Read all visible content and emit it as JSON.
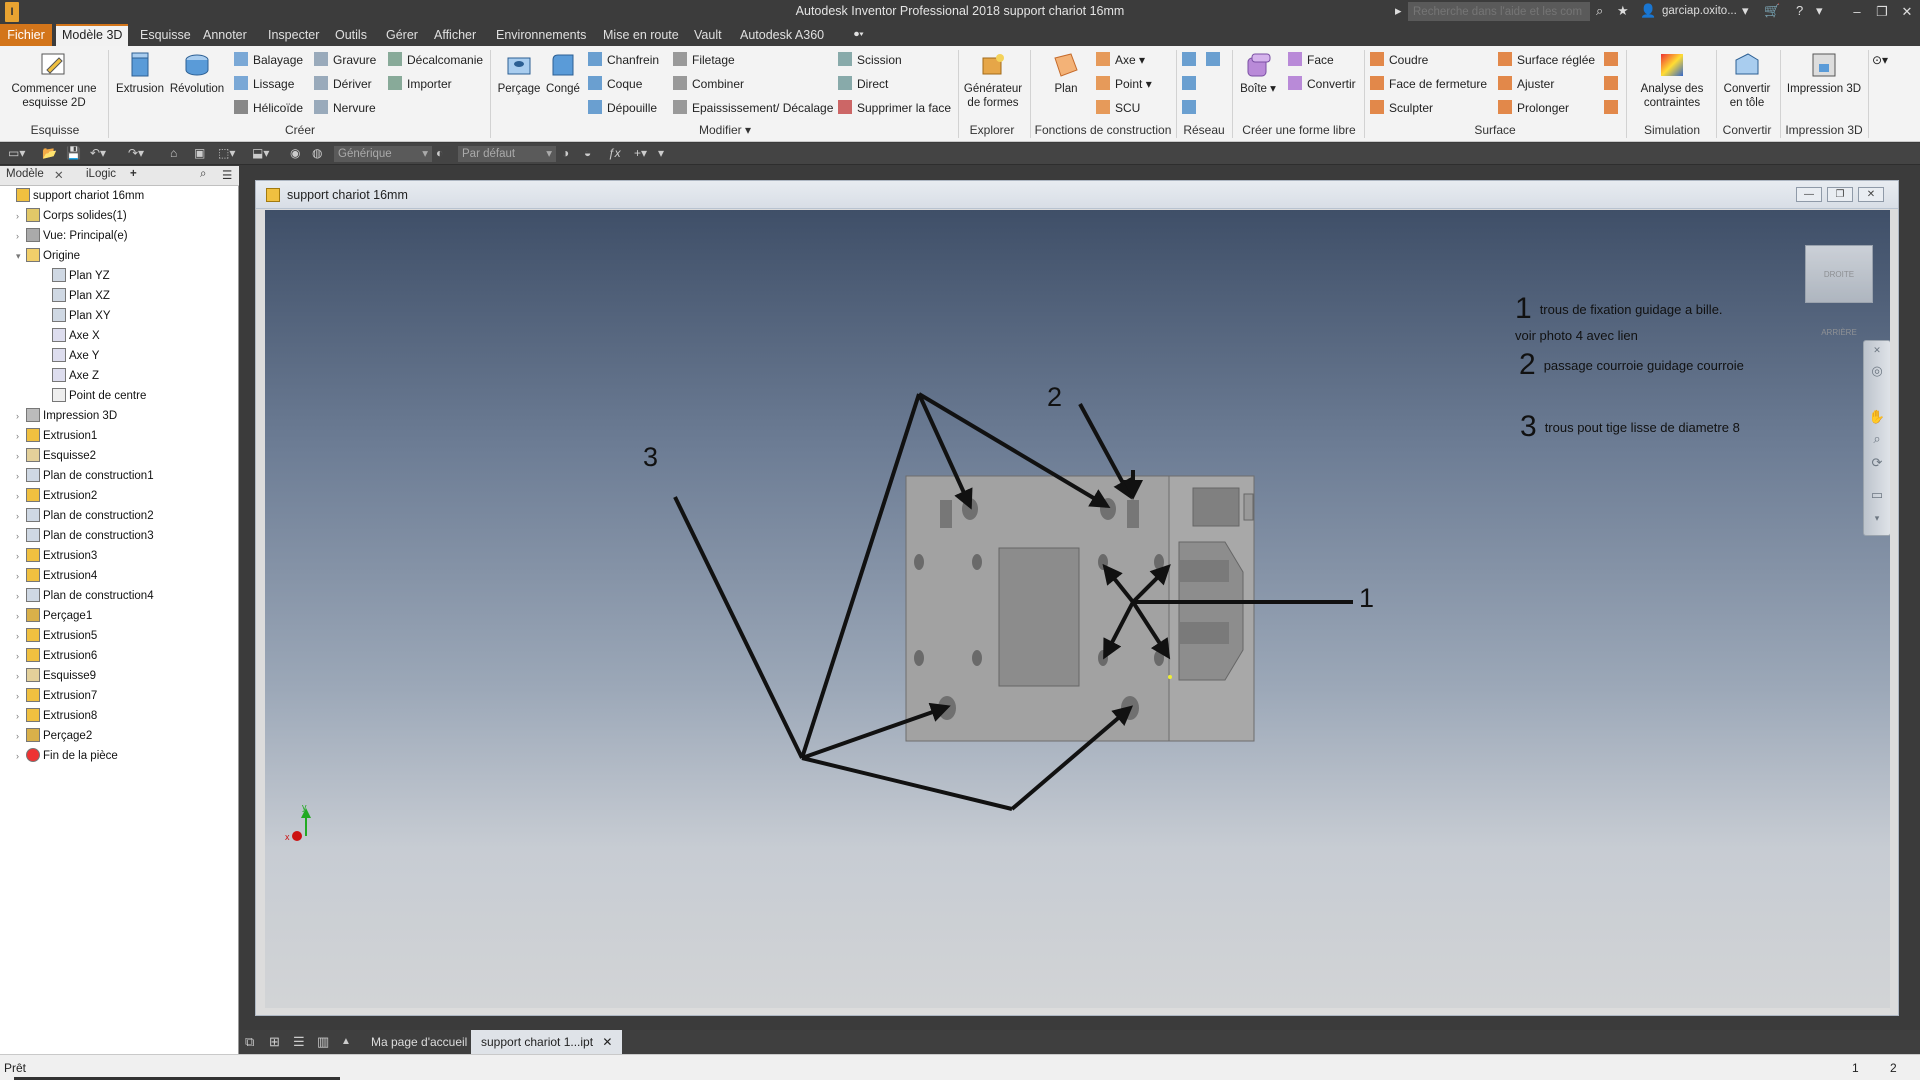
{
  "window": {
    "title": "Autodesk Inventor Professional 2018   support chariot 16mm",
    "logo": "I",
    "help_search_placeholder": "Recherche dans l'aide et les com",
    "user": "garciap.oxito..."
  },
  "menus": [
    "Fichier",
    "Modèle 3D",
    "Esquisse",
    "Annoter",
    "Inspecter",
    "Outils",
    "Gérer",
    "Afficher",
    "Environnements",
    "Mise en route",
    "Vault",
    "Autodesk A360"
  ],
  "ribbon": {
    "panels": {
      "esquisse": "Esquisse",
      "creer": "Créer",
      "modifier": "Modifier",
      "explorer": "Explorer",
      "fonctions": "Fonctions de construction",
      "reseau": "Réseau",
      "forme_libre": "Créer une forme libre",
      "surface": "Surface",
      "simulation": "Simulation",
      "convertir": "Convertir",
      "impression": "Impression 3D"
    },
    "buttons": {
      "commencer": "Commencer une esquisse 2D",
      "extrusion": "Extrusion",
      "revolution": "Révolution",
      "balayage": "Balayage",
      "lissage": "Lissage",
      "helicoide": "Hélicoïde",
      "gravure": "Gravure",
      "deriver": "Dériver",
      "nervure": "Nervure",
      "decalcomanie": "Décalcomanie",
      "importer": "Importer",
      "percage": "Perçage",
      "conge": "Congé",
      "chanfrein": "Chanfrein",
      "coque": "Coque",
      "depouille": "Dépouille",
      "filetage": "Filetage",
      "combiner": "Combiner",
      "epaississement": "Epaississement/ Décalage",
      "scission": "Scission",
      "direct": "Direct",
      "supprimer_face": "Supprimer la face",
      "generateur": "Générateur de formes",
      "plan": "Plan",
      "axe": "Axe",
      "point": "Point",
      "scu": "SCU",
      "boite": "Boîte",
      "face": "Face",
      "convertir_fl": "Convertir",
      "coudre": "Coudre",
      "face_fermeture": "Face de fermeture",
      "sculpter": "Sculpter",
      "surface_reglee": "Surface réglée",
      "ajuster": "Ajuster",
      "prolonger": "Prolonger",
      "analyse": "Analyse des contraintes",
      "convertir_tole": "Convertir en tôle",
      "impression3d": "Impression 3D"
    }
  },
  "qat": {
    "material": "Générique",
    "appearance": "Par défaut"
  },
  "browser": {
    "tabs": [
      "Modèle",
      "iLogic"
    ],
    "items": [
      {
        "label": "support chariot 16mm",
        "level": 0,
        "icon": "part-icon"
      },
      {
        "label": "Corps solides(1)",
        "level": 1,
        "icon": "solid-bodies-icon"
      },
      {
        "label": "Vue: Principal(e)",
        "level": 1,
        "icon": "view-icon"
      },
      {
        "label": "Origine",
        "level": 1,
        "icon": "folder-icon"
      },
      {
        "label": "Plan YZ",
        "level": 2,
        "icon": "plane-icon"
      },
      {
        "label": "Plan XZ",
        "level": 2,
        "icon": "plane-icon"
      },
      {
        "label": "Plan XY",
        "level": 2,
        "icon": "plane-icon"
      },
      {
        "label": "Axe X",
        "level": 2,
        "icon": "axis-icon"
      },
      {
        "label": "Axe Y",
        "level": 2,
        "icon": "axis-icon"
      },
      {
        "label": "Axe Z",
        "level": 2,
        "icon": "axis-icon"
      },
      {
        "label": "Point de centre",
        "level": 2,
        "icon": "point-icon"
      },
      {
        "label": "Impression 3D",
        "level": 1,
        "icon": "print3d-icon"
      },
      {
        "label": "Extrusion1",
        "level": 1,
        "icon": "extrusion-icon"
      },
      {
        "label": "Esquisse2",
        "level": 1,
        "icon": "sketch-icon"
      },
      {
        "label": "Plan de construction1",
        "level": 1,
        "icon": "plane-icon"
      },
      {
        "label": "Extrusion2",
        "level": 1,
        "icon": "extrusion-icon"
      },
      {
        "label": "Plan de construction2",
        "level": 1,
        "icon": "plane-icon"
      },
      {
        "label": "Plan de construction3",
        "level": 1,
        "icon": "plane-icon"
      },
      {
        "label": "Extrusion3",
        "level": 1,
        "icon": "extrusion-icon"
      },
      {
        "label": "Extrusion4",
        "level": 1,
        "icon": "extrusion-icon"
      },
      {
        "label": "Plan de construction4",
        "level": 1,
        "icon": "plane-icon"
      },
      {
        "label": "Perçage1",
        "level": 1,
        "icon": "hole-icon"
      },
      {
        "label": "Extrusion5",
        "level": 1,
        "icon": "extrusion-icon"
      },
      {
        "label": "Extrusion6",
        "level": 1,
        "icon": "extrusion-icon"
      },
      {
        "label": "Esquisse9",
        "level": 1,
        "icon": "sketch-icon"
      },
      {
        "label": "Extrusion7",
        "level": 1,
        "icon": "extrusion-icon"
      },
      {
        "label": "Extrusion8",
        "level": 1,
        "icon": "extrusion-icon"
      },
      {
        "label": "Perçage2",
        "level": 1,
        "icon": "hole-icon"
      },
      {
        "label": "Fin de la pièce",
        "level": 1,
        "icon": "end-of-part-icon"
      }
    ]
  },
  "document": {
    "title": "support chariot 16mm"
  },
  "annotations": {
    "legend": [
      {
        "num": "1",
        "text": "trous de fixation guidage a bille.",
        "line2": "voir photo 4 avec lien"
      },
      {
        "num": "2",
        "text": "passage courroie guidage courroie"
      },
      {
        "num": "3",
        "text": "trous pout tige lisse de diametre 8"
      }
    ],
    "labels": {
      "one": "1",
      "two": "2",
      "three": "3"
    }
  },
  "viewcube": {
    "text": "DROITE  ARRIÈRE"
  },
  "triad": {
    "x": "x",
    "y": "y"
  },
  "doc_tabs": [
    "Ma page d'accueil",
    "support chariot 1...ipt"
  ],
  "status": {
    "text": "Prêt",
    "n1": "1",
    "n2": "2"
  },
  "colors": {
    "accent": "#d3751a",
    "viewport_top": "#3f4f68",
    "viewport_bottom": "#d2d4d6"
  }
}
